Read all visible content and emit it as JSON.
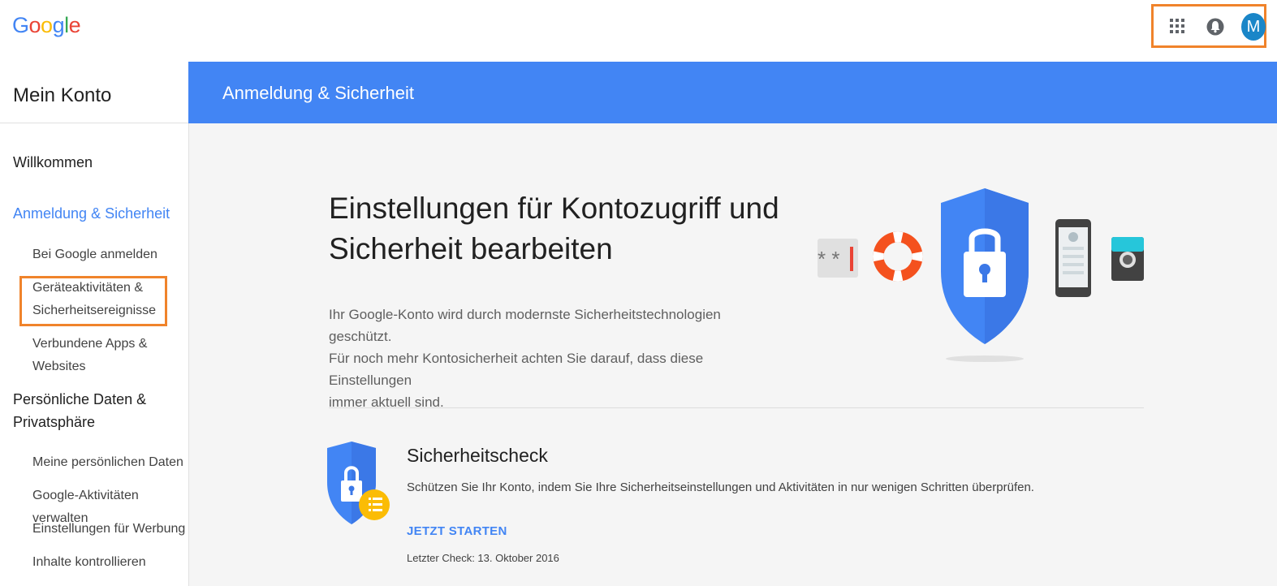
{
  "header": {
    "logo": [
      "G",
      "o",
      "o",
      "g",
      "l",
      "e"
    ],
    "logo_colors": [
      "#4285f4",
      "#ea4335",
      "#fbbc05",
      "#4285f4",
      "#34a853",
      "#ea4335"
    ],
    "avatar_initial": "M"
  },
  "sidebar": {
    "title": "Mein Konto",
    "items": [
      {
        "label": "Willkommen"
      },
      {
        "label": "Anmeldung & Sicherheit",
        "active": true
      },
      {
        "label": "Bei Google anmelden"
      },
      {
        "label": "Geräteaktivitäten &"
      },
      {
        "label": "Sicherheitsereignisse"
      },
      {
        "label": "Verbundene Apps & Websites"
      },
      {
        "label": "Persönliche Daten &"
      },
      {
        "label": "Privatsphäre"
      },
      {
        "label": "Meine persönlichen Daten"
      },
      {
        "label": "Google-Aktivitäten verwalten"
      },
      {
        "label": "Einstellungen für Werbung"
      },
      {
        "label": "Inhalte kontrollieren"
      }
    ]
  },
  "band": {
    "title": "Anmeldung & Sicherheit"
  },
  "main": {
    "hero_title_line1": "Einstellungen für Kontozugriff und",
    "hero_title_line2": "Sicherheit bearbeiten",
    "hero_text_line1": "Ihr Google-Konto wird durch modernste Sicherheitstechnologien geschützt.",
    "hero_text_line2": "Für noch mehr Kontosicherheit achten Sie darauf, dass diese Einstellungen",
    "hero_text_line3": "immer aktuell sind.",
    "password_stars": "* *",
    "check_title": "Sicherheitscheck",
    "check_desc": "Schützen Sie Ihr Konto, indem Sie Ihre Sicherheitseinstellungen und Aktivitäten in nur wenigen Schritten überprüfen.",
    "check_link": "JETZT STARTEN",
    "check_last": "Letzter Check: 13. Oktober 2016"
  },
  "colors": {
    "accent": "#4285f4",
    "highlight": "#f0832b"
  }
}
